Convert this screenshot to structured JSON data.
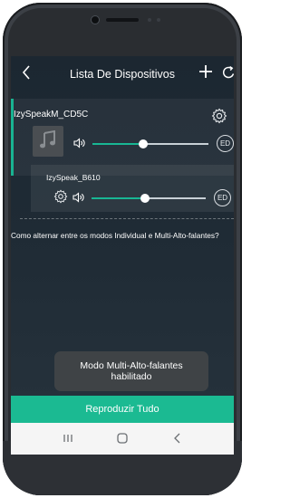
{
  "header": {
    "title": "Lista De Dispositivos",
    "back_icon": "chevron-left-icon",
    "add_icon": "plus-icon",
    "refresh_icon": "refresh-icon"
  },
  "devices": [
    {
      "name": "IzySpeakM_CD5C",
      "volume_fraction": 0.44,
      "mode_badge": "ED",
      "album_art_icon": "music-note-icon",
      "selected": true
    },
    {
      "name": "IzySpeak_B610",
      "volume_fraction": 0.47,
      "mode_badge": "ED"
    }
  ],
  "help_link": "Como alternar entre os modos Individual e Multi-Alto-falantes?",
  "toast": "Modo Multi-Alto-falantes habilitado",
  "play_all": "Reproduzir Tudo",
  "colors": {
    "accent": "#19b392",
    "screen_background": "#1f2a33"
  }
}
